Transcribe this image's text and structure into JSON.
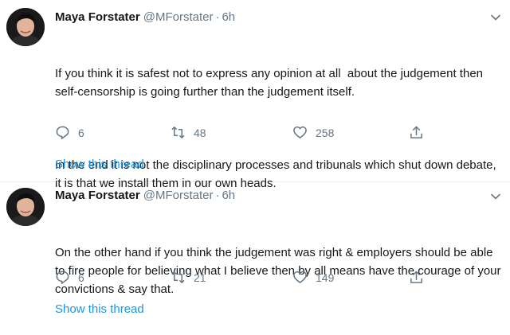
{
  "tweets": [
    {
      "name": "Maya Forstater",
      "handle": "@MForstater",
      "separator": "·",
      "time": "6h",
      "paragraphs": [
        "If you think it is safest not to express any opinion at all  about the judgement then self-censorship is going further than the judgement itself.",
        "In the end it is not the disciplinary processes and tribunals which shut down debate, it is that we install them in our own heads."
      ],
      "replies": "6",
      "retweets": "48",
      "likes": "258",
      "show_thread": "Show this thread"
    },
    {
      "name": "Maya Forstater",
      "handle": "@MForstater",
      "separator": "·",
      "time": "6h",
      "paragraphs": [
        "On the other hand if you think the judgement was right & employers should be able to fire people for believing what I believe then by all means have the courage of your convictions & say that."
      ],
      "replies": "6",
      "retweets": "21",
      "likes": "149",
      "show_thread": "Show this thread"
    }
  ],
  "colors": {
    "link": "#1b95e0",
    "muted": "#657786",
    "text": "#14171a",
    "divider": "#e6ecf0"
  },
  "icons": [
    "avatar",
    "chevron-down-icon",
    "reply-icon",
    "retweet-icon",
    "like-icon",
    "share-icon"
  ]
}
